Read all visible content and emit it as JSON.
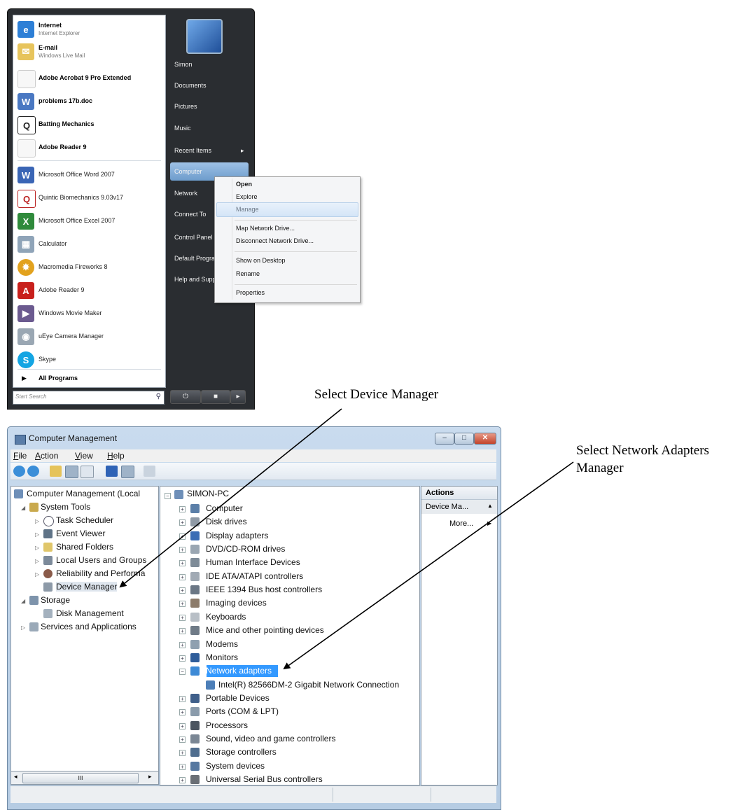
{
  "start_menu": {
    "pinned": [
      {
        "title": "Internet",
        "subtitle": "Internet Explorer"
      },
      {
        "title": "E-mail",
        "subtitle": "Windows Live Mail"
      }
    ],
    "recent": [
      {
        "label": "Adobe Acrobat 9 Pro Extended",
        "bold": true
      },
      {
        "label": "problems 17b.doc",
        "bold": true
      },
      {
        "label": "Batting Mechanics",
        "bold": true
      },
      {
        "label": "Adobe Reader 9",
        "bold": true
      },
      {
        "label": "Microsoft Office Word 2007",
        "bold": false
      },
      {
        "label": "Quintic Biomechanics 9.03v17",
        "bold": false
      },
      {
        "label": "Microsoft Office Excel 2007",
        "bold": false
      },
      {
        "label": "Calculator",
        "bold": false
      },
      {
        "label": "Macromedia Fireworks 8",
        "bold": false
      },
      {
        "label": "Adobe Reader 9",
        "bold": false
      },
      {
        "label": "Windows Movie Maker",
        "bold": false
      },
      {
        "label": "uEye Camera Manager",
        "bold": false
      },
      {
        "label": "Skype",
        "bold": false
      }
    ],
    "all_programs": "All Programs",
    "search_placeholder": "Start Search",
    "right_items": [
      "Simon",
      "Documents",
      "Pictures",
      "Music",
      "Recent Items",
      "Computer",
      "Network",
      "Connect To",
      "Control Panel",
      "Default Programs",
      "Help and Support"
    ],
    "recent_items_arrow": "▸"
  },
  "context_menu": {
    "items": [
      "Open",
      "Explore",
      "Manage",
      "Map Network Drive...",
      "Disconnect Network Drive...",
      "Show on Desktop",
      "Rename",
      "Properties"
    ]
  },
  "callouts": {
    "device_manager": "Select Device Manager",
    "network_line1": "Select Network Adapters",
    "network_line2": "Manager"
  },
  "comp_mgmt": {
    "title": "Computer Management",
    "menu": [
      {
        "first": "F",
        "rest": "ile"
      },
      {
        "first": "A",
        "rest": "ction"
      },
      {
        "first": "V",
        "rest": "iew"
      },
      {
        "first": "H",
        "rest": "elp"
      }
    ],
    "left_tree": [
      "Computer Management (Local",
      "System Tools",
      "Task Scheduler",
      "Event Viewer",
      "Shared Folders",
      "Local Users and Groups",
      "Reliability and Performa",
      "Device Manager",
      "Storage",
      "Disk Management",
      "Services and Applications"
    ],
    "device_root": "SIMON-PC",
    "devices": [
      "Computer",
      "Disk drives",
      "Display adapters",
      "DVD/CD-ROM drives",
      "Human Interface Devices",
      "IDE ATA/ATAPI controllers",
      "IEEE 1394 Bus host controllers",
      "Imaging devices",
      "Keyboards",
      "Mice and other pointing devices",
      "Modems",
      "Monitors",
      "Network adapters",
      "Intel(R) 82566DM-2 Gigabit Network Connection",
      "Portable Devices",
      "Ports (COM & LPT)",
      "Processors",
      "Sound, video and game controllers",
      "Storage controllers",
      "System devices",
      "Universal Serial Bus controllers"
    ],
    "actions": {
      "header": "Actions",
      "sub": "Device Ma...",
      "more": "More..."
    },
    "scroll_thumb": "III"
  }
}
